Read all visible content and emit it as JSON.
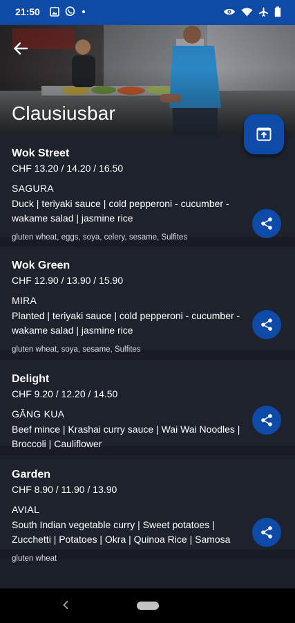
{
  "status_bar": {
    "time": "21:50",
    "left_icons": [
      "image-icon",
      "whatsapp-icon",
      "dot-icon"
    ],
    "right_icons": [
      "eye-icon",
      "wifi-icon",
      "airplane-icon",
      "battery-icon"
    ],
    "color": "#0e4aa8"
  },
  "header": {
    "title": "Clausiusbar",
    "back_icon": "arrow-left-icon",
    "open_icon": "open-in-browser-icon"
  },
  "menus": [
    {
      "title": "Wok Street",
      "price": "CHF 13.20 / 14.20 / 16.50",
      "dish_name": "SAGURA",
      "description": "Duck | teriyaki sauce | cold pepperoni - cucumber - wakame salad | jasmine rice",
      "allergens": "gluten wheat, eggs, soya, celery, sesame, Sulfites"
    },
    {
      "title": "Wok Green",
      "price": "CHF 12.90 / 13.90 / 15.90",
      "dish_name": "MIRA",
      "description": "Planted | teriyaki sauce | cold pepperoni - cucumber - wakame salad | jasmine rice",
      "allergens": "gluten wheat, soya, sesame, Sulfites"
    },
    {
      "title": "Delight",
      "price": "CHF 9.20 / 12.20 / 14.50",
      "dish_name": "GĂNG KUA",
      "description": "Beef mince | Krashai curry sauce | Wai Wai Noodles | Broccoli | Cauliflower",
      "allergens": ""
    },
    {
      "title": "Garden",
      "price": "CHF 8.90 / 11.90 / 13.90",
      "dish_name": "AVIAL",
      "description": "South Indian vegetable curry | Sweet potatoes | Zucchetti | Potatoes | Okra | Quinoa Rice | Samosa",
      "allergens": "gluten wheat"
    }
  ],
  "share_icon": "share-icon",
  "nav_bar": {
    "back_icon": "nav-back-icon",
    "home_icon": "nav-home-pill"
  }
}
